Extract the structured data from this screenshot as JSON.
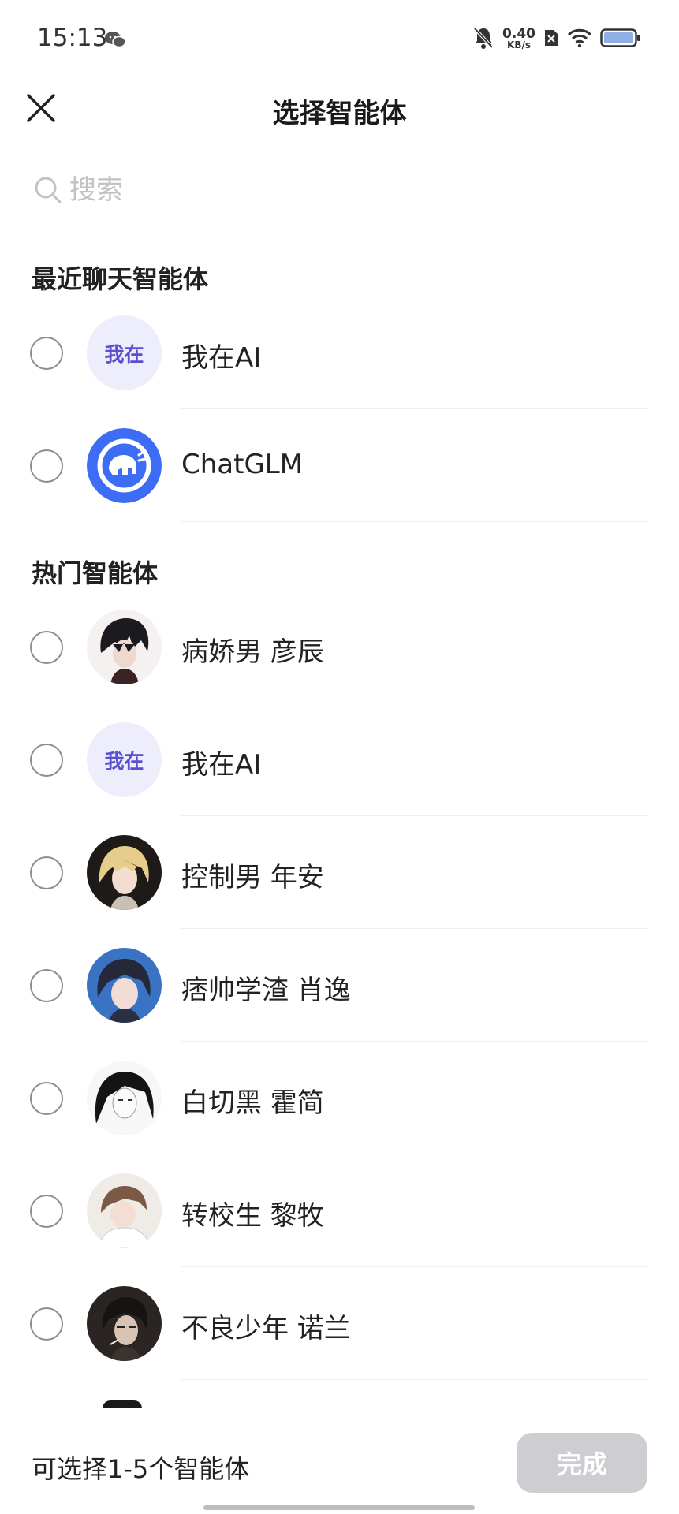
{
  "status_bar": {
    "time": "15:13",
    "net_speed_value": "0.40",
    "net_speed_unit": "KB/s",
    "icons": [
      "wechat-icon",
      "bell-muted-icon",
      "sim-off-icon",
      "wifi-icon",
      "battery-icon"
    ]
  },
  "header": {
    "title": "选择智能体",
    "close_icon": "close-icon"
  },
  "search": {
    "placeholder": "搜索",
    "value": ""
  },
  "sections": {
    "recent": {
      "title": "最近聊天智能体",
      "items": [
        {
          "name": "我在AI",
          "avatar_text": "我在",
          "avatar": "woza-logo"
        },
        {
          "name": "ChatGLM",
          "avatar": "chatglm-elephant-logo"
        }
      ]
    },
    "popular": {
      "title": "热门智能体",
      "items": [
        {
          "name": "病娇男 彦辰",
          "avatar": "character-portrait"
        },
        {
          "name": "我在AI",
          "avatar_text": "我在",
          "avatar": "woza-logo"
        },
        {
          "name": "控制男 年安",
          "avatar": "character-portrait"
        },
        {
          "name": "痞帅学渣 肖逸",
          "avatar": "character-portrait"
        },
        {
          "name": "白切黑 霍简",
          "avatar": "character-portrait"
        },
        {
          "name": "转校生 黎牧",
          "avatar": "character-portrait"
        },
        {
          "name": "不良少年 诺兰",
          "avatar": "character-portrait"
        }
      ]
    }
  },
  "footer": {
    "hint": "可选择1-5个智能体",
    "done_label": "完成"
  },
  "colors": {
    "accent_woza": "#5a4fcf",
    "woza_bg": "#eeedfb",
    "chatglm_blue": "#3d6df5",
    "done_disabled": "#cdcdd2"
  }
}
